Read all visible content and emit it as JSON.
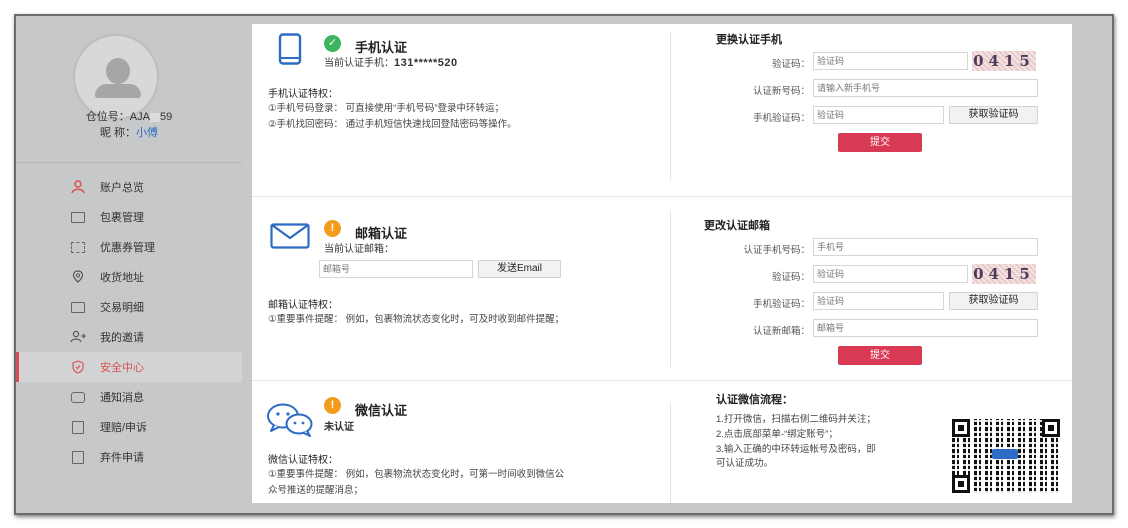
{
  "profile": {
    "account_label": "仓位号：AJA",
    "account_value_tail": "59",
    "nickname_label": "昵 称：",
    "nickname_value": "小傅"
  },
  "nav": [
    {
      "label": "账户总览",
      "icon": "user-icon"
    },
    {
      "label": "包裹管理",
      "icon": "package-icon"
    },
    {
      "label": "优惠券管理",
      "icon": "coupon-icon"
    },
    {
      "label": "收货地址",
      "icon": "location-icon"
    },
    {
      "label": "交易明细",
      "icon": "transaction-icon"
    },
    {
      "label": "我的邀请",
      "icon": "invite-icon"
    },
    {
      "label": "安全中心",
      "icon": "shield-icon",
      "active": true
    },
    {
      "label": "通知消息",
      "icon": "message-icon"
    },
    {
      "label": "理赔/申诉",
      "icon": "claim-icon"
    },
    {
      "label": "弃件申请",
      "icon": "discard-icon"
    }
  ],
  "phone": {
    "title": "手机认证",
    "current_prefix": "当前认证手机：",
    "current_value": "131*****520",
    "privileges_title": "手机认证特权：",
    "privilege_1": "①手机号码登录： 可直接使用“手机号码”登录中环转运；",
    "privilege_2": "②手机找回密码： 通过手机短信快速找回登陆密码等操作。",
    "form_title": "更换认证手机",
    "captcha_label": "验证码：",
    "captcha_placeholder": "验证码",
    "captcha_text": "0415",
    "new_phone_label": "认证新号码：",
    "new_phone_placeholder": "请输入新手机号",
    "sms_label": "手机验证码：",
    "sms_placeholder": "验证码",
    "get_code": "获取验证码",
    "submit": "提交"
  },
  "email": {
    "title": "邮箱认证",
    "current_prefix": "当前认证邮箱：",
    "email_placeholder": "邮箱号",
    "send_button": "发送Email",
    "privileges_title": "邮箱认证特权：",
    "privilege_1": "①重要事件提醒： 例如，包裹物流状态变化时，可及时收到邮件提醒；",
    "form_title": "更改认证邮箱",
    "auth_phone_label": "认证手机号码：",
    "auth_phone_placeholder": "手机号",
    "captcha_label": "验证码：",
    "captcha_placeholder": "验证码",
    "captcha_text": "0415",
    "sms_label": "手机验证码：",
    "sms_placeholder": "验证码",
    "get_code": "获取验证码",
    "new_email_label": "认证新邮箱：",
    "new_email_placeholder": "邮箱号",
    "submit": "提交"
  },
  "wechat": {
    "title": "微信认证",
    "status": "未认证",
    "privileges_title": "微信认证特权：",
    "privilege_1a": "①重要事件提醒： 例如，包裹物流状态变化时，可第一时间收到微信公",
    "privilege_1b": "众号推送的提醒消息；",
    "flow_title": "认证微信流程：",
    "step_1": "1.打开微信，扫描右侧二维码并关注；",
    "step_2": "2.点击底部菜单-“绑定账号”；",
    "step_3a": "3.输入正确的中环转运帐号及密码，即",
    "step_3b": "可认证成功。"
  },
  "colors": {
    "accent_red": "#d83a54",
    "success_green": "#3bb55f",
    "warning_orange": "#f39c1c",
    "link_blue": "#2a6cc4"
  }
}
